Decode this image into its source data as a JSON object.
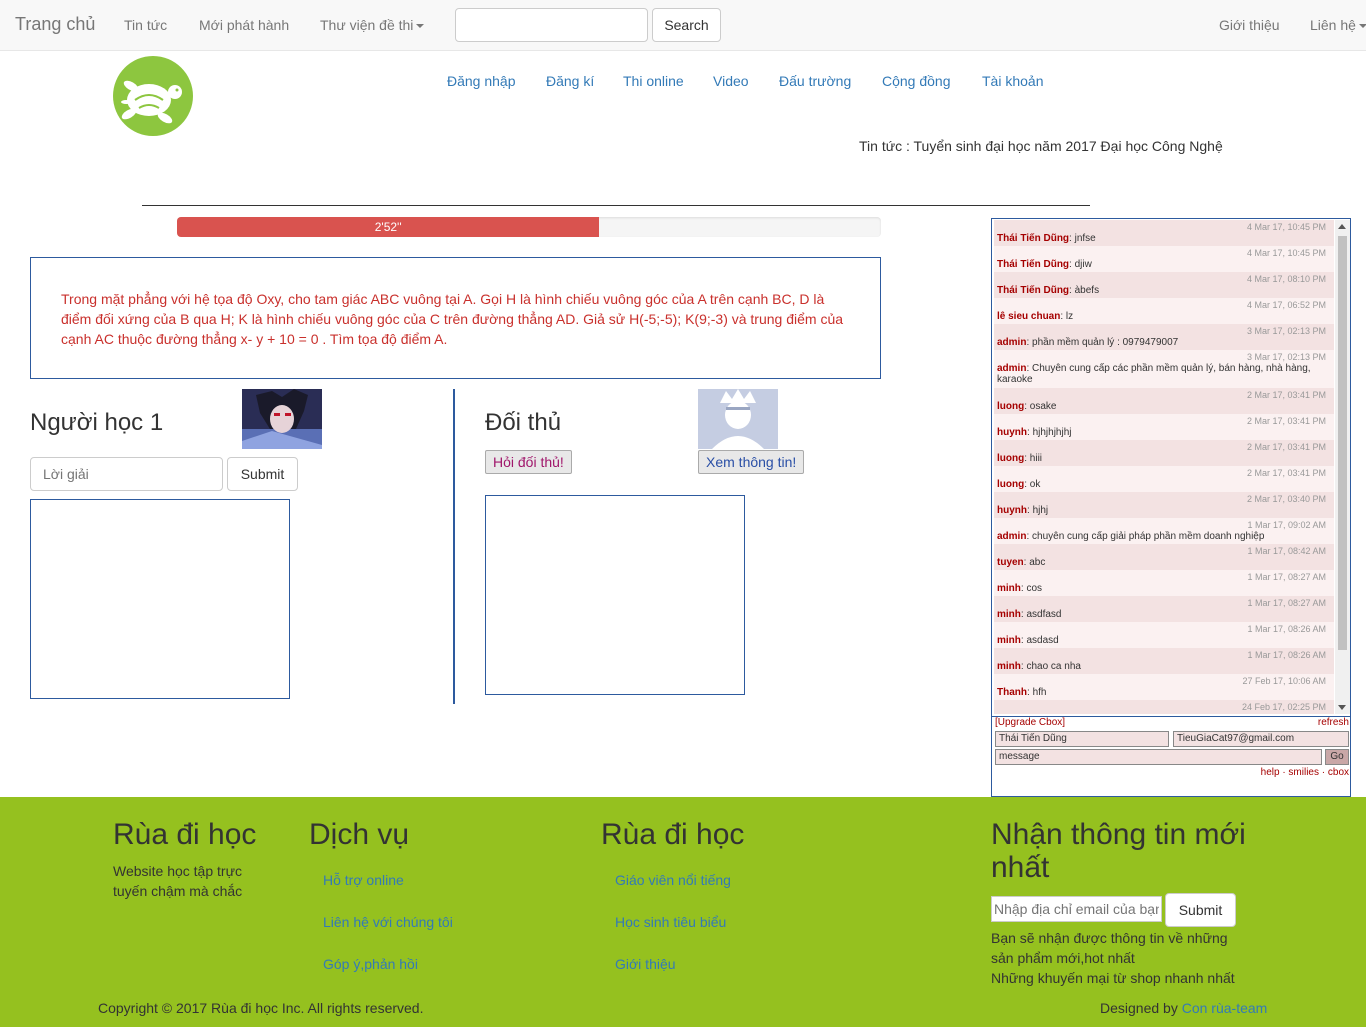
{
  "navbar": {
    "brand": "Trang chủ",
    "links": [
      "Tin tức",
      "Mới phát hành"
    ],
    "library_label": "Thư viện đề thi",
    "search_button": "Search",
    "right_links": [
      "Giới thiệu"
    ],
    "contact_label": "Liên hệ"
  },
  "subnav": [
    "Đăng nhập",
    "Đăng kí",
    "Thi online",
    "Video",
    "Đấu trường",
    "Cộng đồng",
    "Tài khoản"
  ],
  "news_line": "Tin tức : Tuyển sinh đại học năm 2017 Đại học Công Nghệ",
  "separator": "___________________________________________________________________________________________________________",
  "progress": {
    "label": "2'52''",
    "fraction": 0.6
  },
  "question": "Trong mặt phẳng với hệ tọa độ Oxy, cho tam giác ABC vuông tại A. Gọi H là hình chiếu vuông góc của A trên cạnh BC, D là điểm đối xứng của B qua H; K là hình chiếu vuông góc của C trên đường thẳng AD. Giả sử H(-5;-5); K(9;-3) và trung điểm của cạnh AC thuộc đường thẳng x- y + 10 = 0 . Tìm tọa độ điểm A.",
  "player": {
    "title": "Người học 1",
    "answer_placeholder": "Lời giải",
    "submit": "Submit"
  },
  "opponent": {
    "title": "Đối thủ",
    "ask_button": "Hỏi đối thủ!",
    "info_button": "Xem thông tin!"
  },
  "chat": {
    "messages": [
      {
        "time": "4 Mar 17, 10:45 PM",
        "user": "Thái Tiến Dũng",
        "text": "jnfse"
      },
      {
        "time": "4 Mar 17, 10:45 PM",
        "user": "Thái Tiến Dũng",
        "text": "djiw"
      },
      {
        "time": "4 Mar 17, 08:10 PM",
        "user": "Thái Tiến Dũng",
        "text": "àbefs"
      },
      {
        "time": "4 Mar 17, 06:52 PM",
        "user": "lê sieu chuan",
        "text": "lz"
      },
      {
        "time": "3 Mar 17, 02:13 PM",
        "user": "admin",
        "text": "phần mềm quản lý : 0979479007"
      },
      {
        "time": "3 Mar 17, 02:13 PM",
        "user": "admin",
        "text": "Chuyên cung cấp các phần mềm quản lý, bán hàng, nhà hàng, karaoke"
      },
      {
        "time": "2 Mar 17, 03:41 PM",
        "user": "luong",
        "text": "osake"
      },
      {
        "time": "2 Mar 17, 03:41 PM",
        "user": "huynh",
        "text": "hjhjhjhjhj"
      },
      {
        "time": "2 Mar 17, 03:41 PM",
        "user": "luong",
        "text": "hiii"
      },
      {
        "time": "2 Mar 17, 03:41 PM",
        "user": "luong",
        "text": "ok"
      },
      {
        "time": "2 Mar 17, 03:40 PM",
        "user": "huynh",
        "text": "hjhj"
      },
      {
        "time": "1 Mar 17, 09:02 AM",
        "user": "admin",
        "text": "chuyên cung cấp giải pháp phần mềm doanh nghiệp"
      },
      {
        "time": "1 Mar 17, 08:42 AM",
        "user": "tuyen",
        "text": "abc"
      },
      {
        "time": "1 Mar 17, 08:27 AM",
        "user": "minh",
        "text": "cos"
      },
      {
        "time": "1 Mar 17, 08:27 AM",
        "user": "minh",
        "text": "asdfasd"
      },
      {
        "time": "1 Mar 17, 08:26 AM",
        "user": "minh",
        "text": "asdasd"
      },
      {
        "time": "1 Mar 17, 08:26 AM",
        "user": "minh",
        "text": "chao ca nha"
      },
      {
        "time": "27 Feb 17, 10:06 AM",
        "user": "Thanh",
        "text": "hfh"
      },
      {
        "time": "24 Feb 17, 02:25 PM",
        "user": "",
        "text": ""
      }
    ],
    "upgrade": "[Upgrade Cbox]",
    "refresh": "refresh",
    "name_value": "Thái Tiến Dũng",
    "email_value": "TieuGiaCat97@gmail.com",
    "message_placeholder": "message",
    "go": "Go",
    "footer_links": "help · smilies · cbox"
  },
  "footer": {
    "col1_title": "Rùa đi học",
    "col1_text": "Website học tập trực tuyến chậm mà chắc",
    "col2_title": "Dịch vụ",
    "col2_links": [
      "Hỗ trợ online",
      "Liên hệ với chúng tôi",
      "Góp ý,phản hồi"
    ],
    "col3_title": "Rùa đi học",
    "col3_links": [
      "Giáo viên nổi tiếng",
      "Học sinh tiêu biểu",
      "Giới thiệu"
    ],
    "col4_title": "Nhận thông tin mới nhất",
    "email_placeholder": "Nhập địa chỉ email của bạn",
    "submit": "Submit",
    "col4_text1": "Bạn sẽ nhận được thông tin về những sản phẩm mới,hot nhất",
    "col4_text2": "Những khuyến mại từ shop nhanh nhất",
    "copyright": "Copyright © 2017 Rùa đi học Inc. All rights reserved.",
    "designed_prefix": "Designed by ",
    "designed_link": "Con rùa-team"
  }
}
